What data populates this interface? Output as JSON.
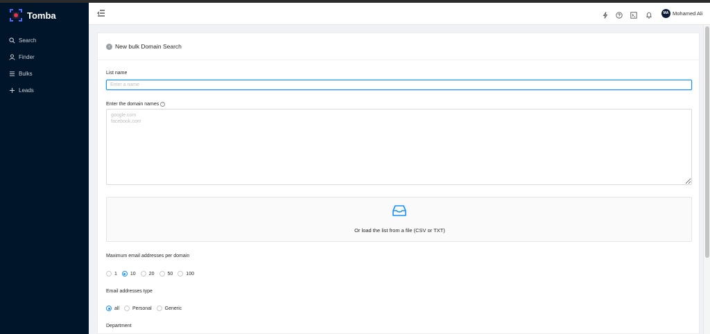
{
  "app": {
    "name": "Tomba"
  },
  "nav": [
    {
      "label": "Search",
      "icon": "search-icon"
    },
    {
      "label": "Finder",
      "icon": "user-icon"
    },
    {
      "label": "Bulks",
      "icon": "list-icon"
    },
    {
      "label": "Leads",
      "icon": "plus-icon"
    }
  ],
  "header": {
    "icons": [
      "lightning-icon",
      "help-icon",
      "terminal-icon",
      "bell-icon"
    ],
    "user": {
      "initials": "MA",
      "name": "Mohamed Ali"
    }
  },
  "page": {
    "title": "New bulk Domain Search"
  },
  "form": {
    "list_name": {
      "label": "List name",
      "placeholder": "Enter a name",
      "value": ""
    },
    "domains": {
      "label": "Enter the domain names",
      "placeholder": "google.com\nfacebook.com"
    },
    "upload": {
      "text": "Or load the list from a file (CSV or TXT)",
      "icon": "inbox-icon"
    },
    "max_emails": {
      "label": "Maximum email addresses per domain",
      "options": [
        "1",
        "10",
        "20",
        "50",
        "100"
      ],
      "selected": "10"
    },
    "email_type": {
      "label": "Email addresses type",
      "options": [
        "all",
        "Personal",
        "Generic"
      ],
      "selected": "all"
    },
    "department": {
      "label": "Department"
    }
  },
  "colors": {
    "sidebar": "#001529",
    "primary": "#1890ff",
    "brand": "#e8334a"
  }
}
